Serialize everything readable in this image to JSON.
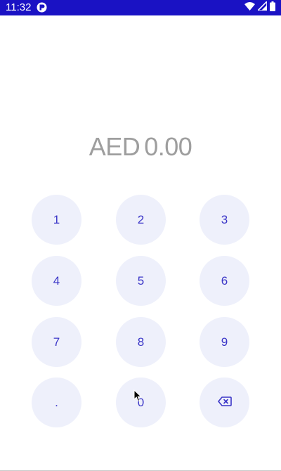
{
  "status_bar": {
    "time": "11:32",
    "app_icon": "app-notification-icon",
    "icons": [
      "wifi-icon",
      "cellular-signal-icon",
      "battery-icon"
    ]
  },
  "amount": {
    "currency": "AED",
    "value": "0.00"
  },
  "keypad": {
    "keys": [
      {
        "label": "1"
      },
      {
        "label": "2"
      },
      {
        "label": "3"
      },
      {
        "label": "4"
      },
      {
        "label": "5"
      },
      {
        "label": "6"
      },
      {
        "label": "7"
      },
      {
        "label": "8"
      },
      {
        "label": "9"
      },
      {
        "label": "."
      },
      {
        "label": "0"
      },
      {
        "icon": "backspace-icon"
      }
    ]
  },
  "colors": {
    "status_bar_bg": "#1a12c4",
    "key_bg": "#eef0fb",
    "key_text": "#3a35c7",
    "amount_text": "#9e9e9e"
  }
}
